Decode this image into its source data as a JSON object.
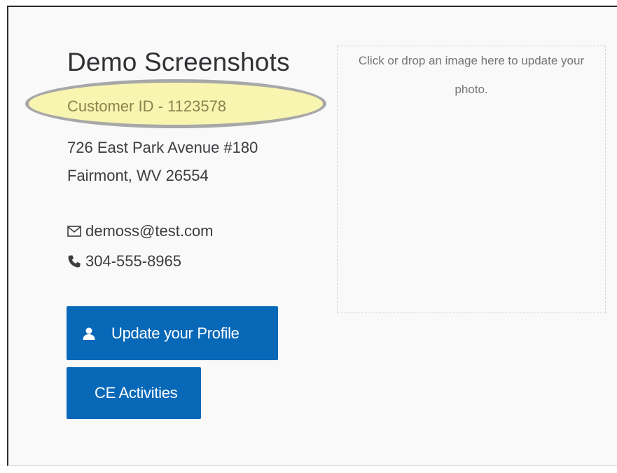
{
  "profile": {
    "name": "Demo Screenshots",
    "customer_id": "Customer ID - 1123578",
    "address_line1": "726 East Park Avenue #180",
    "address_line2": "Fairmont, WV 26554",
    "email": "demoss@test.com",
    "phone": "304-555-8965"
  },
  "icons": {
    "email": "envelope-icon",
    "phone": "phone-icon",
    "user": "user-icon"
  },
  "buttons": {
    "update_profile": "Update your Profile",
    "ce_activities": "CE Activities"
  },
  "photo": {
    "dropzone_text": "Click or drop an image here to update your photo."
  },
  "colors": {
    "button_bg": "#0868b8",
    "highlight_fill": "#f8f5b0",
    "highlight_border": "#a8a8a8"
  }
}
